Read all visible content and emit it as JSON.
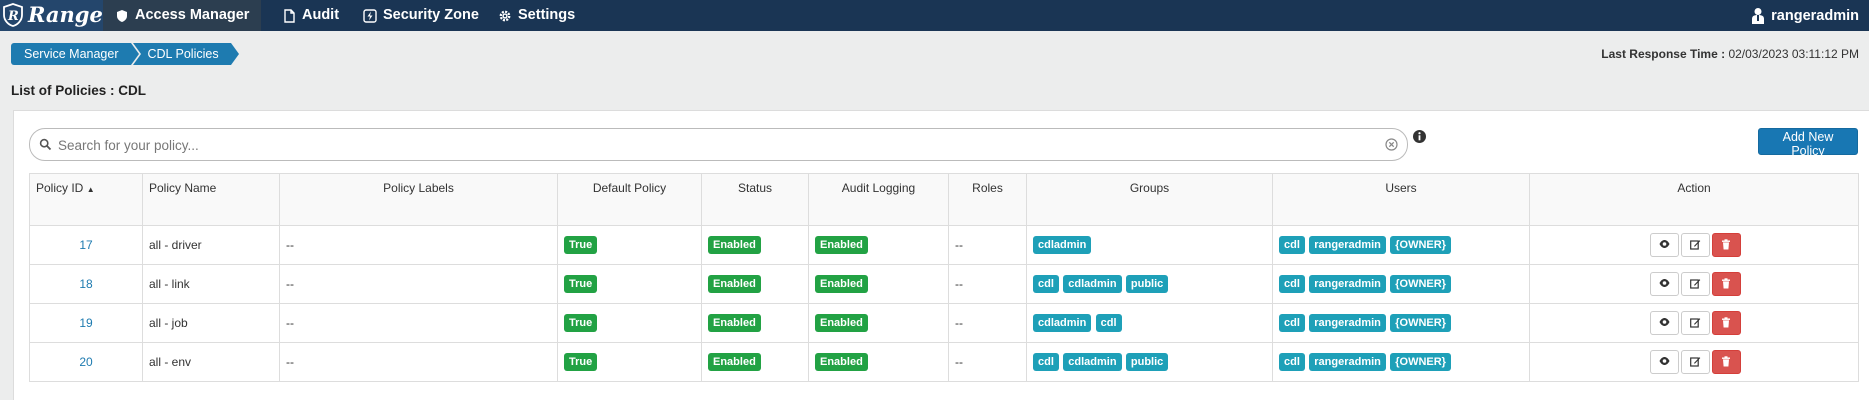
{
  "nav": {
    "brand": "Ranger",
    "items": [
      {
        "label": "Access Manager",
        "icon": "shield-icon",
        "active": true
      },
      {
        "label": "Audit",
        "icon": "file-icon",
        "active": false
      },
      {
        "label": "Security Zone",
        "icon": "bolt-icon",
        "active": false
      },
      {
        "label": "Settings",
        "icon": "gear-icon",
        "active": false
      }
    ],
    "user": "rangeradmin"
  },
  "breadcrumb": [
    "Service Manager",
    "CDL Policies"
  ],
  "response_time": {
    "label": "Last Response Time :",
    "value": "02/03/2023 03:11:12 PM"
  },
  "page_title": "List of Policies : CDL",
  "search": {
    "placeholder": "Search for your policy...",
    "value": ""
  },
  "add_button": "Add New Policy",
  "table": {
    "columns": [
      "Policy ID",
      "Policy Name",
      "Policy Labels",
      "Default Policy",
      "Status",
      "Audit Logging",
      "Roles",
      "Groups",
      "Users",
      "Action"
    ],
    "rows": [
      {
        "id": "17",
        "name": "all - driver",
        "labels": "--",
        "default": "True",
        "status": "Enabled",
        "audit": "Enabled",
        "roles": "--",
        "groups": [
          "cdladmin"
        ],
        "users": [
          "cdl",
          "rangeradmin",
          "{OWNER}"
        ]
      },
      {
        "id": "18",
        "name": "all - link",
        "labels": "--",
        "default": "True",
        "status": "Enabled",
        "audit": "Enabled",
        "roles": "--",
        "groups": [
          "cdl",
          "cdladmin",
          "public"
        ],
        "users": [
          "cdl",
          "rangeradmin",
          "{OWNER}"
        ]
      },
      {
        "id": "19",
        "name": "all - job",
        "labels": "--",
        "default": "True",
        "status": "Enabled",
        "audit": "Enabled",
        "roles": "--",
        "groups": [
          "cdladmin",
          "cdl"
        ],
        "users": [
          "cdl",
          "rangeradmin",
          "{OWNER}"
        ]
      },
      {
        "id": "20",
        "name": "all - env",
        "labels": "--",
        "default": "True",
        "status": "Enabled",
        "audit": "Enabled",
        "roles": "--",
        "groups": [
          "cdl",
          "cdladmin",
          "public"
        ],
        "users": [
          "cdl",
          "rangeradmin",
          "{OWNER}"
        ]
      }
    ]
  },
  "colors": {
    "nav_bg": "#1a3554",
    "brand_bg": "#24466c",
    "primary": "#1e7bb0",
    "success": "#22a244",
    "info": "#1ea0b8",
    "danger": "#d9534f"
  }
}
